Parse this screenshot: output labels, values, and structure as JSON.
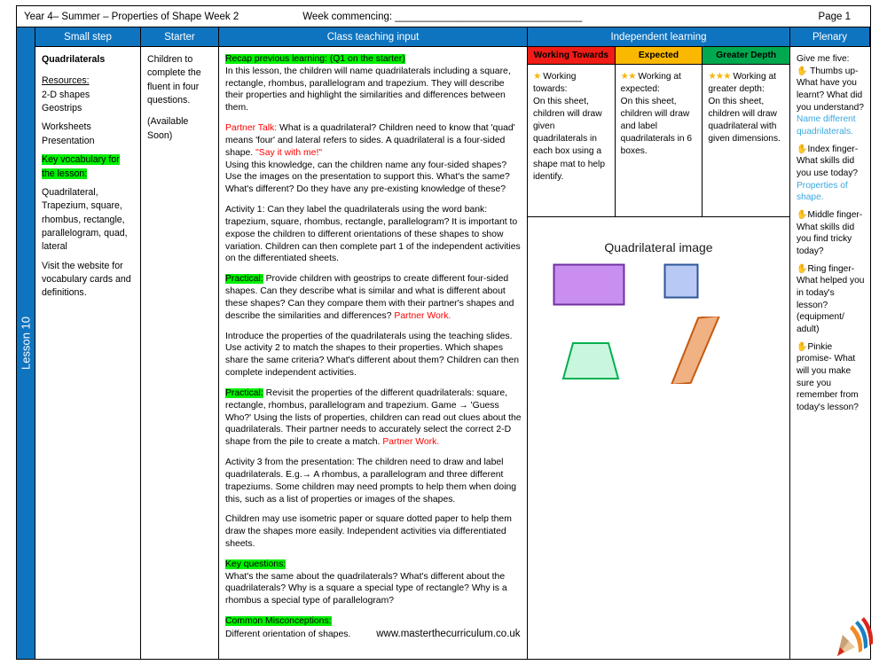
{
  "meta": {
    "left": "Year 4– Summer – Properties of Shape Week 2",
    "week_commencing": "Week commencing: _________________________________",
    "page": "Page 1"
  },
  "spine": {
    "label": "Lesson 10"
  },
  "headers": {
    "small_step": "Small step",
    "starter": "Starter",
    "class_teaching_input": "Class teaching input",
    "independent_learning": "Independent learning",
    "plenary": "Plenary"
  },
  "small_step": {
    "title": "Quadrilaterals",
    "resources_label": "Resources:",
    "resources": [
      "2-D shapes",
      "Geostrips"
    ],
    "materials": [
      "Worksheets",
      "Presentation"
    ],
    "key_vocab_label": "Key vocabulary for the lesson:",
    "key_vocab": "Quadrilateral, Trapezium, square, rhombus, rectangle, parallelogram, quad, lateral",
    "website_note": "Visit the website for vocabulary cards and definitions."
  },
  "starter": {
    "text": "Children to complete the fluent in four questions.",
    "availability": "(Available Soon)"
  },
  "teaching": {
    "recap_label": "Recap previous learning: (Q1 on the starter)",
    "recap_body": "In this lesson, the children will name quadrilaterals including a square, rectangle, rhombus, parallelogram and trapezium. They will describe their properties and highlight the similarities and differences between them.",
    "partner_talk_label": "Partner Talk:",
    "partner_talk_body": "What is a quadrilateral?  Children need to know that 'quad' means 'four' and lateral refers to sides. A quadrilateral is a four-sided shape.",
    "say_it": "\"Say it with me!\"",
    "using_knowledge": "Using this knowledge, can the children name any four-sided shapes? Use the images on the presentation to support this. What's the same? What's different? Do they have any pre-existing knowledge of these?",
    "activity1": "Activity 1: Can they label the quadrilaterals using the word bank: trapezium, square, rhombus, rectangle, parallelogram? It is important to expose the children to different orientations of these shapes to show variation. Children can then complete part 1 of the independent activities on the differentiated sheets.",
    "practical1_label": "Practical:",
    "practical1_body": "Provide children with geostrips to create different four-sided shapes. Can they describe what is similar and what is different about these shapes? Can they compare them with their partner's shapes and describe the similarities and differences?",
    "partner_work1": "Partner Work.",
    "properties_intro": "Introduce the properties of the quadrilaterals using the teaching slides. Use activity 2 to match the shapes to their properties. Which shapes share the same criteria? What's different about them? Children can then complete independent activities.",
    "practical2_label": "Practical:",
    "practical2_body": "Revisit the properties of the different quadrilaterals: square, rectangle, rhombus, parallelogram and trapezium. Game → 'Guess Who?' Using the lists of properties, children can read out clues about the quadrilaterals. Their partner needs to accurately select the correct 2-D shape from the pile to create a match.",
    "partner_work2": "Partner Work.",
    "activity3": "Activity 3 from the presentation: The children need to draw and label quadrilaterals. E.g.→ A rhombus, a parallelogram and three different trapeziums. Some children may need prompts to help them when doing this, such as a list of properties or images of the shapes.",
    "isometric": "Children may use isometric paper or square dotted paper to help them draw the shapes more easily. Independent activities via differentiated sheets.",
    "key_questions_label": "Key questions:",
    "key_questions_body": "What's the same about the quadrilaterals? What's different about the quadrilaterals? Why is a square a special type of rectangle? Why is a rhombus a special type of parallelogram?",
    "misconceptions_label": "Common Misconceptions:",
    "misconceptions_body": "Different orientation of shapes.",
    "website": "www.masterthecurriculum.co.uk"
  },
  "independent": {
    "columns": [
      {
        "header": "Working Towards",
        "header_color": "#f01c16",
        "stars": "★",
        "title": "Working towards:",
        "body": "On this sheet, children will draw given quadrilaterals in each box using a shape mat to help identify."
      },
      {
        "header": "Expected",
        "header_color": "#fbb800",
        "stars": "★★",
        "title": "Working at expected:",
        "body": "On this sheet, children will draw and label quadrilaterals in 6 boxes."
      },
      {
        "header": "Greater Depth",
        "header_color": "#00a94f",
        "stars": "★★★",
        "title": "Working at greater depth:",
        "body": "On this sheet, children will draw quadrilateral with given dimensions."
      }
    ],
    "image_title": "Quadrilateral image",
    "shapes": [
      {
        "name": "rectangle",
        "fill": "#c98ef0",
        "stroke": "#7030a0"
      },
      {
        "name": "square",
        "fill": "#b8c9f5",
        "stroke": "#2f5597"
      },
      {
        "name": "trapezium",
        "fill": "#c9f7de",
        "stroke": "#00b050"
      },
      {
        "name": "parallelogram",
        "fill": "#f0b183",
        "stroke": "#c55a11"
      }
    ]
  },
  "plenary": {
    "intro": "Give me five:",
    "items": [
      {
        "hand": "✋",
        "question": "Thumbs up- What have you learnt? What did you understand?",
        "answer": "Name different quadrilaterals."
      },
      {
        "hand": "✋",
        "question": "Index finger- What skills did you use today?",
        "answer": "Properties of shape."
      },
      {
        "hand": "✋",
        "question": "Middle finger- What skills did you find tricky today?",
        "answer": ""
      },
      {
        "hand": "✋",
        "question": "Ring finger- What helped you in today's lesson? (equipment/ adult)",
        "answer": ""
      },
      {
        "hand": "✋",
        "question": "Pinkie promise- What will you make sure you remember from today's lesson?",
        "answer": ""
      }
    ]
  }
}
